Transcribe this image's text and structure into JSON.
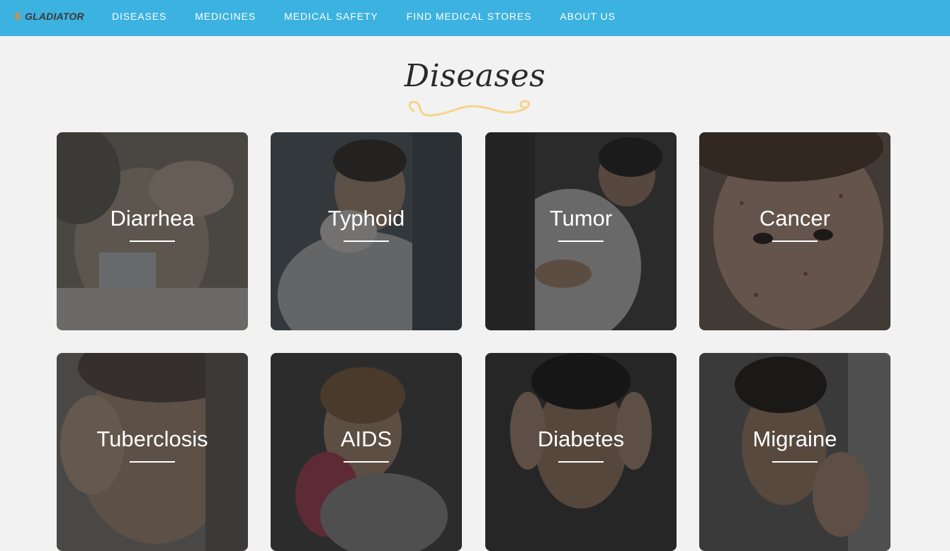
{
  "header": {
    "logo_text": "GLADIATOR",
    "nav": [
      {
        "label": "DISEASES"
      },
      {
        "label": "MEDICINES"
      },
      {
        "label": "MEDICAL SAFETY"
      },
      {
        "label": "FIND MEDICAL STORES"
      },
      {
        "label": "ABOUT US"
      }
    ]
  },
  "main": {
    "title": "Diseases",
    "cards": [
      {
        "label": "Diarrhea"
      },
      {
        "label": "Typhoid"
      },
      {
        "label": "Tumor"
      },
      {
        "label": "Cancer"
      },
      {
        "label": "Tuberclosis"
      },
      {
        "label": "AIDS"
      },
      {
        "label": "Diabetes"
      },
      {
        "label": "Migraine"
      }
    ]
  },
  "colors": {
    "nav_bg": "#3cb2e0",
    "page_bg": "#f2f2f2",
    "swirl": "#f5d58a",
    "logo_accent": "#f08a24"
  }
}
